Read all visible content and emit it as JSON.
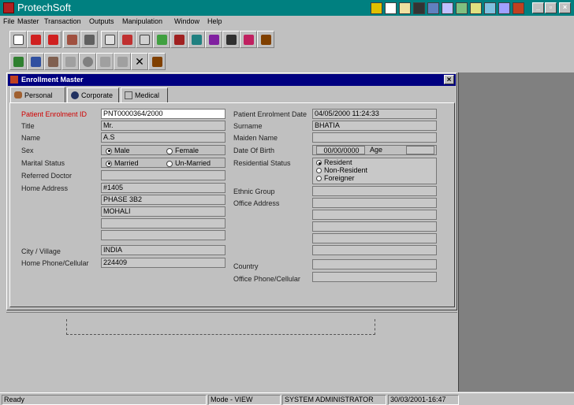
{
  "app": {
    "title": "ProtechSoft"
  },
  "menu": [
    "File",
    "Master",
    "Transaction",
    "Outputs",
    "Manipulation",
    "Window",
    "Help"
  ],
  "window": {
    "title": "Enrollment Master",
    "close": "×"
  },
  "tabs": [
    "Personal",
    "Corporate",
    "Medical"
  ],
  "left": {
    "patient_id": {
      "label": "Patient Enrolment ID",
      "value": "PNT0000364/2000"
    },
    "title": {
      "label": "Title",
      "value": "Mr."
    },
    "name": {
      "label": "Name",
      "value": "A.S"
    },
    "sex": {
      "label": "Sex",
      "male": "Male",
      "female": "Female"
    },
    "marital": {
      "label": "Marital Status",
      "married": "Married",
      "unmarried": "Un-Married"
    },
    "doctor": {
      "label": "Referred Doctor",
      "value": ""
    },
    "address": {
      "label": "Home Address",
      "lines": [
        "#1405",
        "PHASE 3B2",
        "MOHALI",
        "",
        ""
      ]
    },
    "city": {
      "label": "City / Village",
      "value": "INDIA"
    },
    "phone": {
      "label": "Home Phone/Cellular",
      "value": "224409"
    }
  },
  "right": {
    "enrol_date": {
      "label": "Patient Enrolment Date",
      "value": "04/05/2000 11:24:33"
    },
    "surname": {
      "label": "Surname",
      "value": "BHATIA"
    },
    "maiden": {
      "label": "Maiden Name",
      "value": ""
    },
    "dob": {
      "label": "Date Of Birth",
      "value": "00/00/0000",
      "age_label": "Age",
      "age": ""
    },
    "residential": {
      "label": "Residential Status",
      "options": [
        "Resident",
        "Non-Resident",
        "Foreigner"
      ]
    },
    "ethnic": {
      "label": "Ethnic Group",
      "value": ""
    },
    "office_address": {
      "label": "Office Address"
    },
    "country": {
      "label": "Country",
      "value": ""
    },
    "office_phone": {
      "label": "Office Phone/Cellular",
      "value": ""
    }
  },
  "status": {
    "ready": "Ready",
    "mode": "Mode - VIEW",
    "user": "SYSTEM ADMINISTRATOR",
    "datetime": "30/03/2001-16:47"
  }
}
